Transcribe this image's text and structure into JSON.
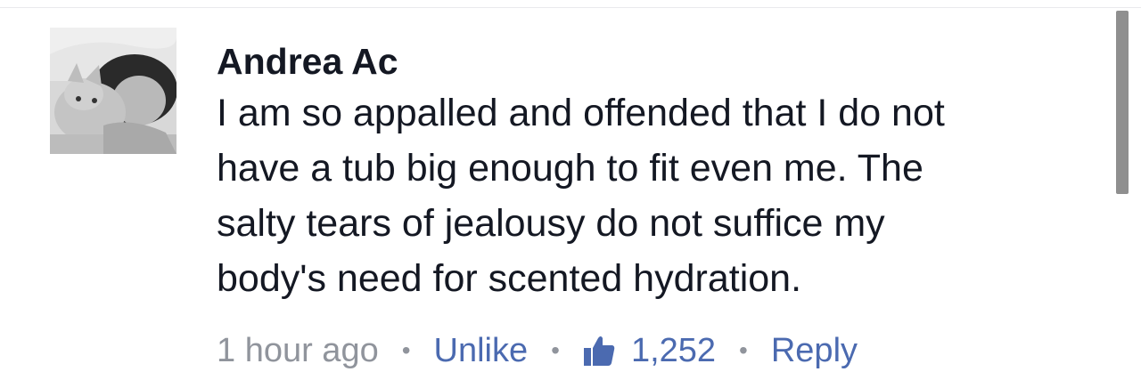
{
  "comment": {
    "author": "Andrea Ac",
    "text_lines": [
      "I am so appalled and offended that I do not",
      "have a tub big enough to fit even me. The",
      "salty tears of jealousy do not suffice my",
      "body's need for scented hydration."
    ],
    "timestamp": "1 hour ago",
    "unlike_label": "Unlike",
    "like_count": "1,252",
    "reply_label": "Reply",
    "separator": "•"
  },
  "icons": {
    "like": "thumbs-up-icon"
  },
  "colors": {
    "text": "#141823",
    "meta": "#90949c",
    "link": "#4b6ab0"
  }
}
